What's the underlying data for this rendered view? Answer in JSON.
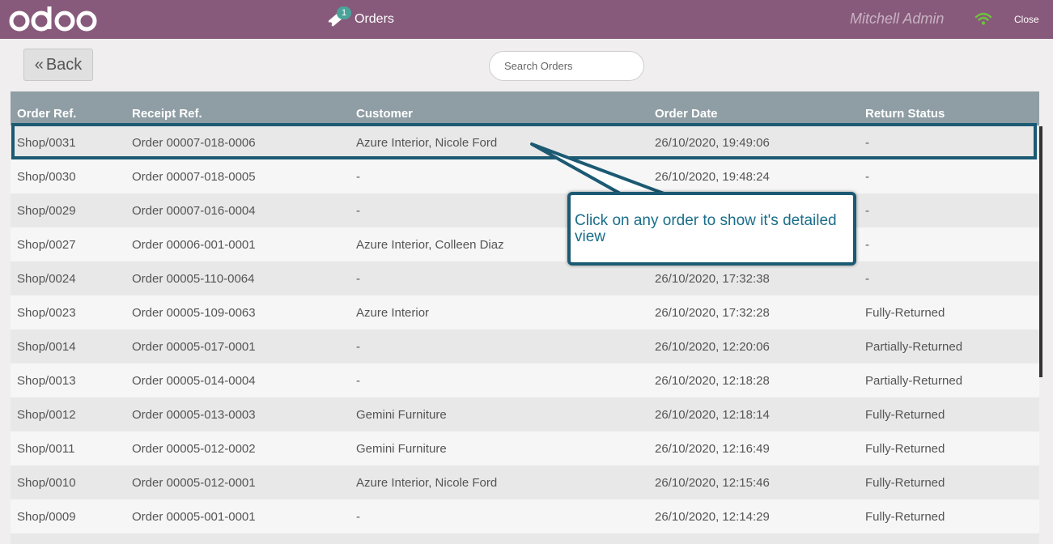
{
  "header": {
    "logo_text": "odoo",
    "orders_badge": "1",
    "orders_label": "Orders",
    "user_name": "Mitchell Admin",
    "close_label": "Close",
    "brand_color": "#875a7b",
    "wifi_color": "#6ec33c"
  },
  "toolbar": {
    "back_label": "Back",
    "search_placeholder": "Search Orders"
  },
  "table": {
    "columns": [
      "Order Ref.",
      "Receipt Ref.",
      "Customer",
      "Order Date",
      "Return Status"
    ],
    "rows": [
      [
        "Shop/0031",
        "Order 00007-018-0006",
        "Azure Interior, Nicole Ford",
        "26/10/2020, 19:49:06",
        "-"
      ],
      [
        "Shop/0030",
        "Order 00007-018-0005",
        "-",
        "26/10/2020, 19:48:24",
        "-"
      ],
      [
        "Shop/0029",
        "Order 00007-016-0004",
        "-",
        "",
        "-"
      ],
      [
        "Shop/0027",
        "Order 00006-001-0001",
        "Azure Interior, Colleen Diaz",
        "",
        "-"
      ],
      [
        "Shop/0024",
        "Order 00005-110-0064",
        "-",
        "26/10/2020, 17:32:38",
        "-"
      ],
      [
        "Shop/0023",
        "Order 00005-109-0063",
        "Azure Interior",
        "26/10/2020, 17:32:28",
        "Fully-Returned"
      ],
      [
        "Shop/0014",
        "Order 00005-017-0001",
        "-",
        "26/10/2020, 12:20:06",
        "Partially-Returned"
      ],
      [
        "Shop/0013",
        "Order 00005-014-0004",
        "-",
        "26/10/2020, 12:18:28",
        "Partially-Returned"
      ],
      [
        "Shop/0012",
        "Order 00005-013-0003",
        "Gemini Furniture",
        "26/10/2020, 12:18:14",
        "Fully-Returned"
      ],
      [
        "Shop/0011",
        "Order 00005-012-0002",
        "Gemini Furniture",
        "26/10/2020, 12:16:49",
        "Fully-Returned"
      ],
      [
        "Shop/0010",
        "Order 00005-012-0001",
        "Azure Interior, Nicole Ford",
        "26/10/2020, 12:15:46",
        "Fully-Returned"
      ],
      [
        "Shop/0009",
        "Order 00005-001-0001",
        "-",
        "26/10/2020, 12:14:29",
        "Fully-Returned"
      ],
      [
        "",
        "",
        "",
        "",
        ""
      ]
    ]
  },
  "tooltip": {
    "text": "Click on any order to show it's detailed view",
    "border_color": "#1c5a73",
    "text_color": "#1a6e8a"
  }
}
